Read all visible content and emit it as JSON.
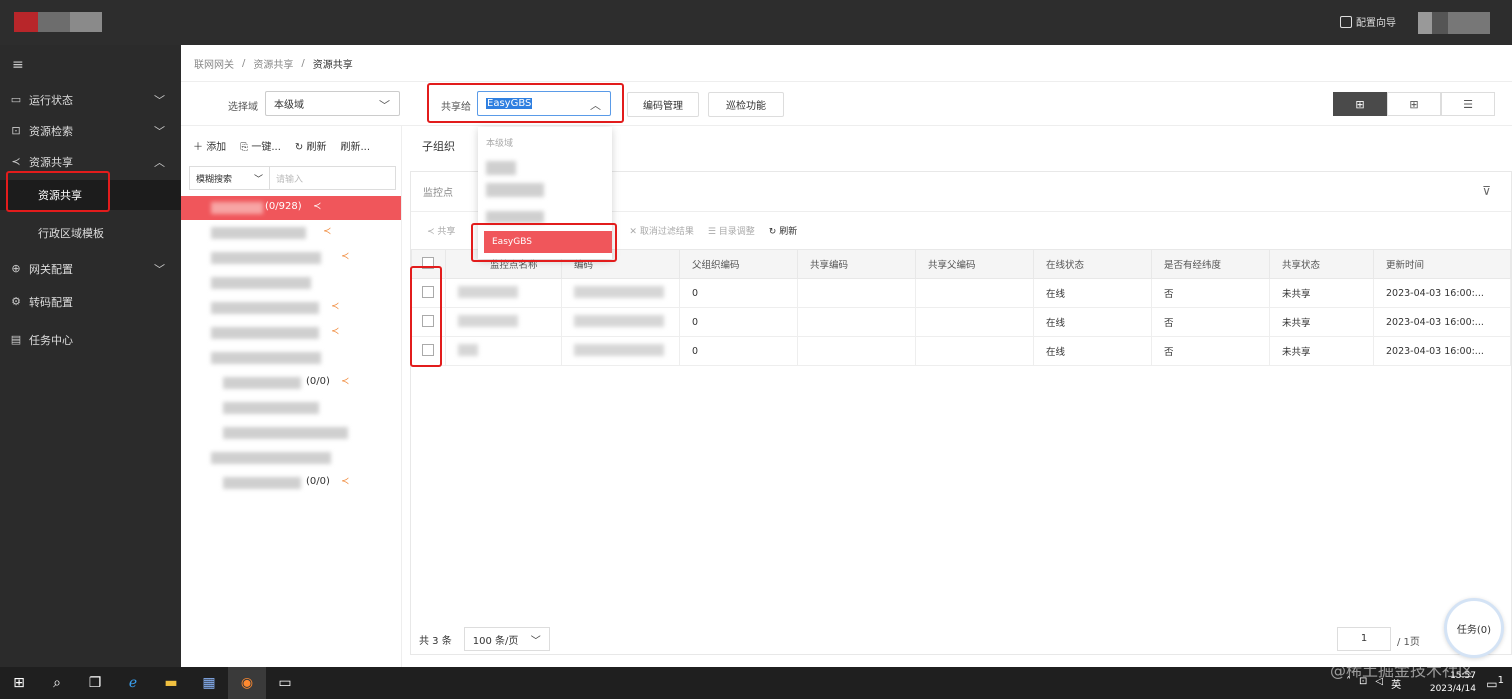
{
  "header": {
    "guide_label": "配置向导"
  },
  "sidebar": {
    "items": [
      {
        "label": "运行状态",
        "icon": "monitor-icon",
        "chev": "﹀"
      },
      {
        "label": "资源检索",
        "icon": "search-doc-icon",
        "chev": "﹀"
      },
      {
        "label": "资源共享",
        "icon": "share-icon",
        "chev": "︿"
      },
      {
        "label": "网关配置",
        "icon": "globe-icon",
        "chev": "﹀"
      },
      {
        "label": "转码配置",
        "icon": "gear-icon",
        "chev": ""
      },
      {
        "label": "任务中心",
        "icon": "task-icon",
        "chev": ""
      }
    ],
    "sub_items": [
      {
        "label": "资源共享"
      },
      {
        "label": "行政区域模板"
      }
    ]
  },
  "breadcrumb": [
    "联网网关",
    "资源共享",
    "资源共享"
  ],
  "toolbar": {
    "domain_label": "选择域",
    "domain_value": "本级域",
    "share_label": "共享给",
    "share_value": "EasyGBS",
    "code_mgmt": "编码管理",
    "patrol": "巡检功能"
  },
  "dropdown": {
    "options": [
      "本级域",
      "EasyGBS"
    ]
  },
  "tree": {
    "tools": [
      "添加",
      "一键...",
      "刷新",
      "刷新..."
    ],
    "search_mode": "模糊搜索",
    "search_placeholder": "请输入",
    "rows": [
      {
        "count": "(0/928)"
      },
      {
        "count": ""
      },
      {
        "count": ""
      },
      {
        "count": ""
      },
      {
        "count": ""
      },
      {
        "count": ""
      },
      {
        "count": ""
      },
      {
        "count": "(0/0)"
      },
      {
        "count": ""
      },
      {
        "count": ""
      },
      {
        "count": ""
      },
      {
        "count": "(0/0)"
      }
    ]
  },
  "content": {
    "tab": "子组织",
    "panel_title": "监控点",
    "actions": [
      "共享",
      "取消过滤结果",
      "目录调整",
      "刷新"
    ],
    "columns": [
      "监控点名称",
      "编码",
      "父组织编码",
      "共享编码",
      "共享父编码",
      "在线状态",
      "是否有经纬度",
      "共享状态",
      "更新时间"
    ],
    "rows": [
      {
        "parent_code": "0",
        "online": "在线",
        "geo": "否",
        "share_status": "未共享",
        "updated": "2023-04-03 16:00:..."
      },
      {
        "parent_code": "0",
        "online": "在线",
        "geo": "否",
        "share_status": "未共享",
        "updated": "2023-04-03 16:00:..."
      },
      {
        "parent_code": "0",
        "online": "在线",
        "geo": "否",
        "share_status": "未共享",
        "updated": "2023-04-03 16:00:..."
      }
    ],
    "total": "共 3 条",
    "page_size": "100 条/页",
    "page_num": "1",
    "page_total": "/ 1页"
  },
  "task_button": "任务(0)",
  "taskbar": {
    "time": "15:57",
    "date": "2023/4/14",
    "ime": "英",
    "notif_count": "1"
  },
  "watermark": "@稀土掘金技术社区",
  "colors": {
    "accent": "#f0565b",
    "highlight_box": "#e21c1c",
    "sidebar": "#2b2b2b"
  }
}
